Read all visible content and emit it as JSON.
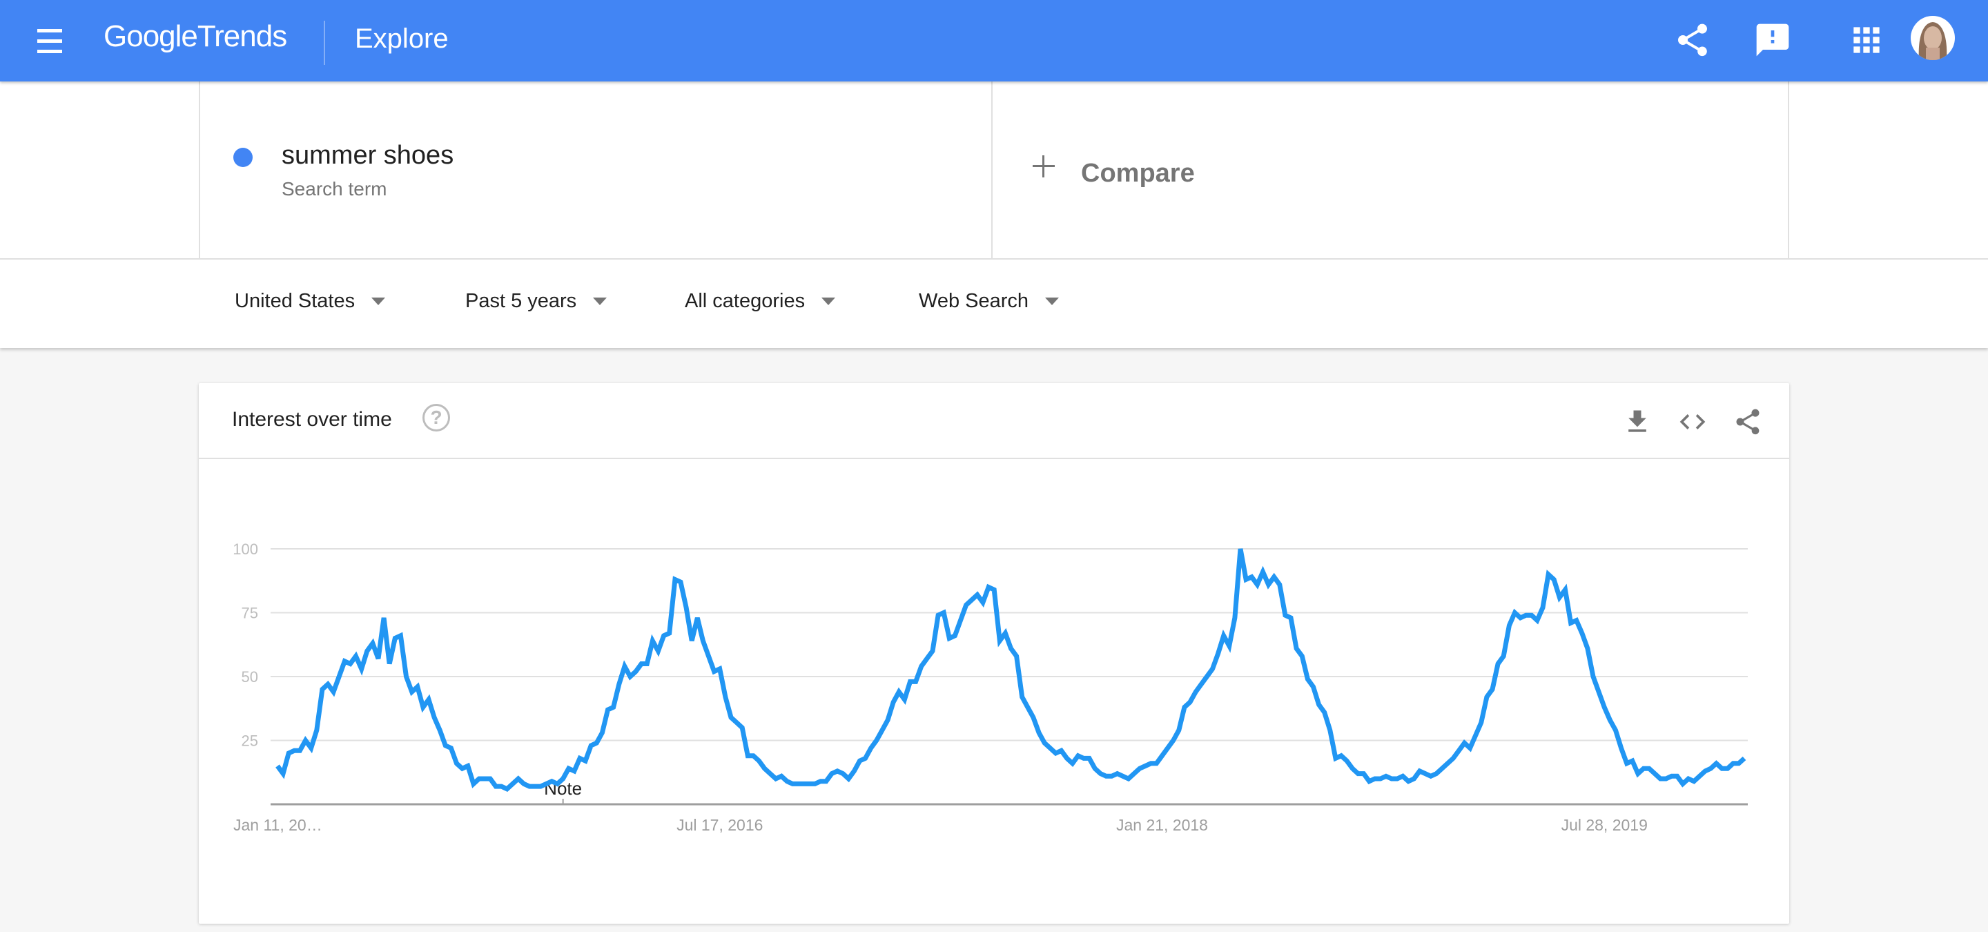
{
  "header": {
    "logo_google": "Google",
    "logo_trends": "Trends",
    "page_title": "Explore",
    "icons": [
      "menu-icon",
      "share-icon",
      "feedback-icon",
      "apps-icon",
      "avatar"
    ],
    "brand_color": "#4285f4"
  },
  "terms": [
    {
      "name": "summer shoes",
      "type": "Search term",
      "color": "#4285f4"
    }
  ],
  "compare": {
    "label": "Compare",
    "icon": "plus-icon"
  },
  "filters": [
    {
      "label": "United States"
    },
    {
      "label": "Past 5 years"
    },
    {
      "label": "All categories"
    },
    {
      "label": "Web Search"
    }
  ],
  "card": {
    "title": "Interest over time",
    "help_icon": "help-icon",
    "actions": [
      "download-icon",
      "embed-icon",
      "share-icon"
    ]
  },
  "chart_data": {
    "type": "line",
    "title": "Interest over time",
    "xlabel": "",
    "ylabel": "",
    "ylim": [
      0,
      100
    ],
    "yticks": [
      25,
      50,
      75,
      100
    ],
    "grid": true,
    "x_tick_labels": [
      "Jan 11, 20…",
      "Jul 17, 2016",
      "Jan 21, 2018",
      "Jul 28, 2019"
    ],
    "x_tick_indices": [
      0,
      79,
      158,
      237
    ],
    "annotation": {
      "label": "Note",
      "index": 51
    },
    "series": [
      {
        "name": "summer shoes",
        "color": "#2196f3",
        "values": [
          15,
          12,
          20,
          21,
          21,
          25,
          22,
          29,
          45,
          47,
          44,
          50,
          56,
          55,
          58,
          53,
          60,
          63,
          57,
          73,
          55,
          65,
          66,
          50,
          44,
          46,
          38,
          41,
          34,
          29,
          23,
          22,
          16,
          14,
          15,
          8,
          10,
          10,
          10,
          7,
          7,
          6,
          8,
          10,
          8,
          7,
          7,
          7,
          8,
          9,
          8,
          10,
          14,
          13,
          18,
          17,
          23,
          24,
          28,
          37,
          38,
          47,
          54,
          50,
          52,
          55,
          55,
          64,
          60,
          66,
          67,
          88,
          87,
          77,
          64,
          73,
          64,
          58,
          52,
          53,
          42,
          34,
          32,
          30,
          19,
          19,
          17,
          14,
          12,
          10,
          11,
          9,
          8,
          8,
          8,
          8,
          8,
          9,
          9,
          12,
          13,
          12,
          10,
          13,
          17,
          18,
          22,
          25,
          29,
          33,
          40,
          44,
          41,
          48,
          48,
          54,
          57,
          60,
          74,
          75,
          65,
          66,
          72,
          78,
          80,
          82,
          79,
          85,
          84,
          64,
          67,
          61,
          58,
          42,
          38,
          34,
          28,
          24,
          22,
          20,
          21,
          18,
          16,
          19,
          18,
          18,
          14,
          12,
          11,
          11,
          12,
          11,
          10,
          12,
          14,
          15,
          16,
          16,
          19,
          22,
          25,
          29,
          38,
          40,
          44,
          47,
          50,
          53,
          59,
          66,
          62,
          73,
          100,
          88,
          89,
          86,
          91,
          86,
          89,
          86,
          74,
          73,
          61,
          58,
          49,
          46,
          39,
          36,
          29,
          18,
          19,
          17,
          14,
          12,
          12,
          9,
          10,
          10,
          11,
          10,
          10,
          11,
          9,
          10,
          13,
          12,
          11,
          12,
          14,
          16,
          18,
          21,
          24,
          22,
          27,
          32,
          42,
          45,
          55,
          58,
          70,
          75,
          73,
          74,
          74,
          72,
          77,
          90,
          88,
          81,
          84,
          71,
          72,
          67,
          61,
          50,
          44,
          38,
          33,
          29,
          22,
          16,
          17,
          12,
          14,
          14,
          12,
          10,
          10,
          11,
          11,
          8,
          10,
          9,
          11,
          13,
          14,
          16,
          14,
          14,
          16,
          16,
          18
        ]
      }
    ]
  }
}
